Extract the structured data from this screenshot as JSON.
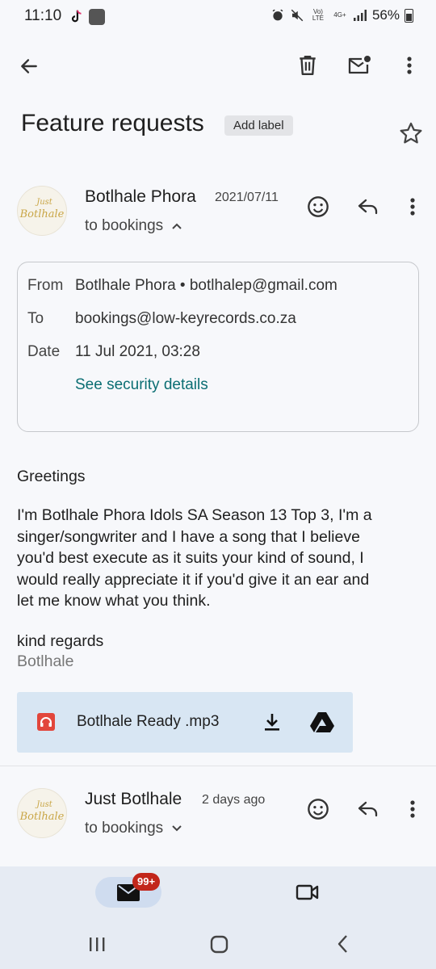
{
  "status_bar": {
    "time": "11:10",
    "signal_label": "Vo) LTE",
    "network_label": "4G+",
    "battery": "56%"
  },
  "toolbar": {
    "back_icon": "arrow-left-icon",
    "delete_icon": "trash-icon",
    "mark_unread_icon": "mail-unread-icon",
    "more_icon": "more-vert-icon"
  },
  "thread": {
    "subject": "Feature requests",
    "add_label": "Add label"
  },
  "message1": {
    "sender": "Botlhale Phora",
    "date": "2021/07/11",
    "to_line": "to bookings",
    "details": {
      "from_label": "From",
      "from_value": "Botlhale Phora • botlhalep@gmail.com",
      "to_label": "To",
      "to_value": "bookings@low-keyrecords.co.za",
      "date_label": "Date",
      "date_value": "11 Jul 2021, 03:28",
      "security_link": "See security details"
    },
    "body": {
      "greeting": "Greetings",
      "paragraph": [
        "I'm Botlhale Phora Idols SA Season 13 Top 3, I'm a",
        "singer/songwriter and I have a song that I believe",
        "you'd best execute as it suits your kind of sound, I",
        "would really appreciate it if you'd give it an ear and",
        "let me know what you think."
      ],
      "signoff": "kind regards",
      "signature": "Botlhale"
    },
    "attachment": {
      "filename": "Botlhale Ready .mp3",
      "file_icon": "audio-file-icon",
      "download_icon": "download-icon",
      "drive_icon": "google-drive-icon"
    }
  },
  "message2": {
    "sender": "Just Botlhale",
    "date": "2 days ago",
    "to_line": "to bookings"
  },
  "avatar_text": {
    "line1": "Just",
    "line2": "Botlhale"
  },
  "bottom_nav": {
    "mail_badge": "99+",
    "mail_icon": "mail-icon",
    "meet_icon": "video-icon"
  },
  "colors": {
    "link": "#0b6e73",
    "attachment_bg": "#d8e6f3",
    "badge": "#c2261b",
    "nav_bg": "#e6ebf3"
  }
}
